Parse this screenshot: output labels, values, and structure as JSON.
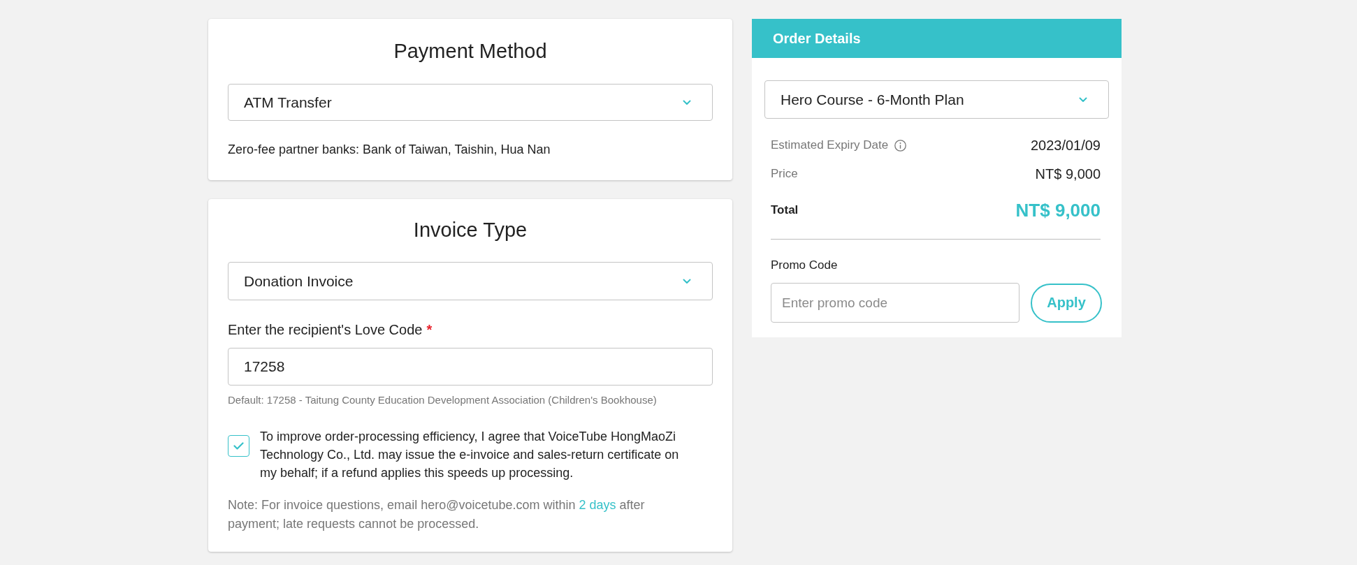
{
  "payment_method": {
    "title": "Payment Method",
    "select": {
      "value": "ATM Transfer"
    },
    "note": "Zero-fee partner banks: Bank of Taiwan, Taishin, Hua Nan"
  },
  "invoice_type": {
    "title": "Invoice Type",
    "select": {
      "value": "Donation Invoice"
    },
    "love_code": {
      "label": "Enter the recipient's Love Code",
      "required_mark": "*",
      "value": "17258",
      "hint": "Default: 17258 - Taitung County Education Development Association (Children's Bookhouse)"
    },
    "consent": {
      "checked": true,
      "text": "To improve order-processing efficiency, I agree that VoiceTube HongMaoZi Technology Co., Ltd. may issue the e-invoice and sales-return certificate on my behalf; if a refund applies this speeds up processing."
    },
    "note": {
      "text_before": "Note: For invoice questions, email hero@voicetube.com within",
      "link": "2 days",
      "text_after": "after payment; late requests cannot be processed."
    }
  },
  "order_details": {
    "title": "Order Details",
    "plan_select": {
      "value": "Hero Course - 6-Month Plan"
    },
    "rows": [
      {
        "kind": "info",
        "label": "Estimated Expiry Date",
        "value": "2023/01/09"
      },
      {
        "kind": "plain",
        "label": "Price",
        "value": "NT$ 9,000"
      },
      {
        "kind": "total",
        "label": "Total",
        "value": "NT$ 9,000"
      }
    ],
    "promo": {
      "label": "Promo Code",
      "placeholder": "Enter promo code",
      "button": "Apply"
    }
  }
}
